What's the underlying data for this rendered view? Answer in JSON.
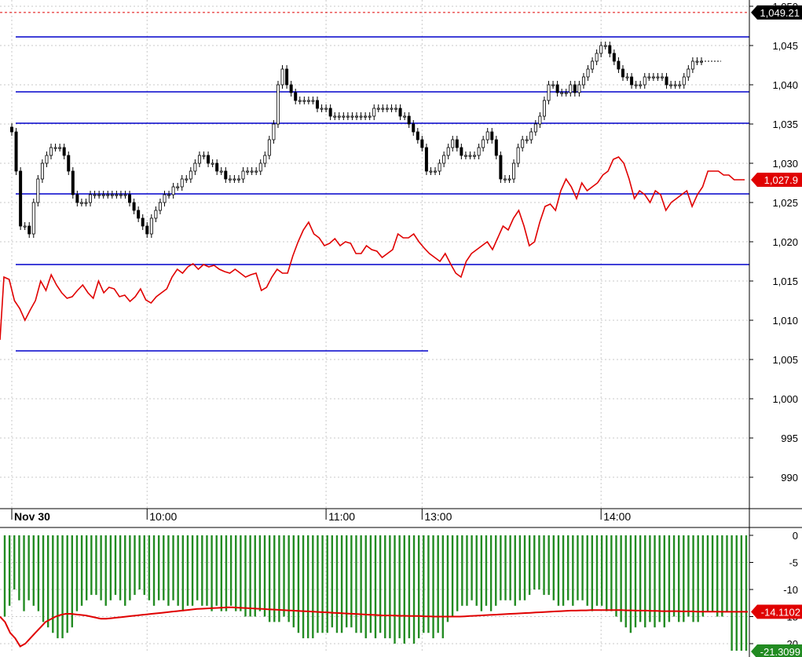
{
  "chart_data": [
    {
      "type": "candlestick",
      "title": "",
      "xlabel": "",
      "ylabel": "",
      "ylim": [
        985,
        1050
      ],
      "yticks": [
        990,
        995,
        1000,
        1005,
        1010,
        1015,
        1020,
        1025,
        1030,
        1035,
        1040,
        1045,
        1050
      ],
      "ytick_labels": [
        "990",
        "995",
        "1,000",
        "1,005",
        "1,010",
        "1,015",
        "1,020",
        "1,025",
        "1,030",
        "1,035",
        "1,040",
        "1,045",
        "1,050"
      ],
      "x_tick_labels": [
        {
          "label": "Nov 30",
          "index": 0
        },
        {
          "label": "10:00",
          "index": 31
        },
        {
          "label": "11:00",
          "index": 72
        },
        {
          "label": "13:00",
          "index": 94
        },
        {
          "label": "14:00",
          "index": 135
        }
      ],
      "grid": true,
      "last_price_line": 1027.9,
      "last_price_label": "1,027.9",
      "reference_line": 1049.21,
      "reference_label": "1,049.21",
      "horizontal_lines": [
        1046.1,
        1039.1,
        1035.1,
        1026.1,
        1017.1,
        1006.1
      ],
      "candles_close": [
        1034,
        1029,
        1022,
        1022,
        1021,
        1025,
        1028,
        1030,
        1031,
        1032,
        1032,
        1032,
        1031,
        1029,
        1026,
        1025,
        1025,
        1025,
        1026,
        1026,
        1026,
        1026,
        1026,
        1026,
        1026,
        1026,
        1026,
        1025,
        1024,
        1023,
        1022,
        1021,
        1023,
        1024,
        1025,
        1026,
        1026,
        1027,
        1027,
        1028,
        1028,
        1029,
        1030,
        1031,
        1031,
        1030,
        1030,
        1029,
        1029,
        1028,
        1028,
        1028,
        1028,
        1029,
        1029,
        1029,
        1029,
        1030,
        1031,
        1033,
        1035,
        1040,
        1042,
        1040,
        1039,
        1038,
        1038,
        1038,
        1038,
        1038,
        1037,
        1037,
        1037,
        1036,
        1036,
        1036,
        1036,
        1036,
        1036,
        1036,
        1036,
        1036,
        1036,
        1037,
        1037,
        1037,
        1037,
        1037,
        1037,
        1036,
        1036,
        1035,
        1034,
        1033,
        1032,
        1029,
        1029,
        1029,
        1030,
        1031,
        1032,
        1033,
        1032,
        1031,
        1031,
        1031,
        1031,
        1032,
        1033,
        1034,
        1033,
        1031,
        1028,
        1028,
        1028,
        1030,
        1032,
        1033,
        1033,
        1034,
        1035,
        1036,
        1038,
        1040,
        1040,
        1039,
        1039,
        1039,
        1040,
        1039,
        1040,
        1041,
        1042,
        1043,
        1044,
        1045,
        1045,
        1044,
        1043,
        1042,
        1041,
        1041,
        1040,
        1040,
        1040,
        1041,
        1041,
        1041,
        1041,
        1041,
        1040,
        1040,
        1040,
        1040,
        1041,
        1042,
        1043,
        1043,
        1043
      ],
      "series": [
        {
          "color": "#e00000",
          "values": [
            1015.5,
            1015.2,
            1012.5,
            1011.5,
            1010.0,
            1011.3,
            1012.5,
            1015.0,
            1013.8,
            1015.8,
            1014.5,
            1013.5,
            1012.8,
            1013.0,
            1013.8,
            1014.5,
            1013.5,
            1012.8,
            1015.0,
            1013.5,
            1014.2,
            1014.0,
            1013.0,
            1013.2,
            1012.4,
            1013.0,
            1014.0,
            1012.6,
            1012.2,
            1013.0,
            1013.5,
            1014.0,
            1015.5,
            1016.5,
            1016.0,
            1016.8,
            1017.2,
            1016.5,
            1017.1,
            1016.8,
            1017.0,
            1016.5,
            1016.2,
            1016.0,
            1016.5,
            1016.0,
            1015.5,
            1015.8,
            1016.0,
            1013.8,
            1014.2,
            1015.5,
            1016.5,
            1016.0,
            1016.0,
            1018.2,
            1020.0,
            1021.5,
            1022.5,
            1021.0,
            1020.5,
            1019.5,
            1019.8,
            1020.4,
            1019.5,
            1020.0,
            1019.8,
            1018.5,
            1018.5,
            1019.5,
            1019.0,
            1018.8,
            1018.0,
            1018.5,
            1019.0,
            1021.0,
            1020.5,
            1020.5,
            1021.0,
            1020.0,
            1019.2,
            1018.5,
            1018.0,
            1017.5,
            1018.5,
            1017.2,
            1016.0,
            1015.5,
            1017.5,
            1018.5,
            1019.0,
            1019.5,
            1020.0,
            1019.0,
            1020.5,
            1022.0,
            1021.5,
            1023.0,
            1024.0,
            1022.0,
            1019.5,
            1020.0,
            1022.5,
            1024.5,
            1024.8,
            1024.0,
            1026.5,
            1028.0,
            1027.0,
            1025.5,
            1027.5,
            1026.5,
            1027.0,
            1027.5,
            1028.5,
            1029.0,
            1030.5,
            1030.8,
            1030.0,
            1028.0,
            1025.5,
            1026.5,
            1026.0,
            1025.0,
            1026.5,
            1026.0,
            1024.0,
            1025.0,
            1025.5,
            1026.0,
            1026.5,
            1024.5,
            1026.0,
            1027.0,
            1029.0,
            1029.0,
            1029.0,
            1028.5,
            1028.5,
            1027.9,
            1027.9,
            1027.9
          ]
        }
      ]
    },
    {
      "type": "bar",
      "title": "",
      "xlabel": "",
      "ylabel": "",
      "ylim": [
        -21,
        1
      ],
      "yticks": [
        0,
        -5,
        -10,
        -15,
        -20
      ],
      "ytick_labels": [
        "0",
        "-5",
        "-10",
        "-15",
        "-20"
      ],
      "last_value_label": "-14.1102",
      "last_value_line": -14.1102,
      "min_value_label": "-21.3099",
      "bar_color": "#228b22",
      "line_color": "#e00000",
      "values": [
        -15,
        -13,
        -10,
        -12,
        -14,
        -12,
        -13,
        -14,
        -16,
        -17,
        -18,
        -19,
        -19,
        -18,
        -17,
        -14,
        -13,
        -12,
        -11,
        -11,
        -12,
        -13,
        -12,
        -11,
        -12,
        -13,
        -12,
        -11,
        -10,
        -11,
        -12,
        -13,
        -12,
        -12,
        -13,
        -12,
        -13,
        -14,
        -13,
        -13,
        -12,
        -13,
        -13,
        -14,
        -13,
        -14,
        -14,
        -13,
        -14,
        -14,
        -15,
        -15,
        -15,
        -14,
        -15,
        -16,
        -16,
        -16,
        -15,
        -16,
        -17,
        -18,
        -19,
        -19,
        -19,
        -18,
        -18,
        -18,
        -17,
        -18,
        -18,
        -17,
        -17,
        -18,
        -18,
        -19,
        -18,
        -19,
        -18,
        -19,
        -19,
        -20,
        -19,
        -20,
        -19,
        -20,
        -19,
        -18,
        -18,
        -19,
        -18,
        -19,
        -16,
        -15,
        -14,
        -13,
        -13,
        -12,
        -13,
        -14,
        -13,
        -14,
        -13,
        -12,
        -12,
        -12,
        -13,
        -12,
        -12,
        -11,
        -10,
        -10,
        -11,
        -11,
        -12,
        -13,
        -13,
        -12,
        -13,
        -12,
        -12,
        -13,
        -14,
        -13,
        -13,
        -14,
        -14,
        -15,
        -16,
        -17,
        -18,
        -17,
        -16,
        -17,
        -16,
        -17,
        -16,
        -17,
        -16,
        -15,
        -16,
        -16,
        -15,
        -16,
        -16,
        -15,
        -14,
        -14,
        -15,
        -15,
        -14,
        -21.3,
        -21.3,
        -21.3,
        -21.3
      ],
      "line_values": [
        -15,
        -16,
        -18,
        -19,
        -20.5,
        -20,
        -19,
        -18,
        -17,
        -16,
        -15.5,
        -15,
        -14.7,
        -14.5,
        -14.5,
        -14.6,
        -14.7,
        -14.8,
        -15,
        -15.2,
        -15.4,
        -15.4,
        -15.3,
        -15.2,
        -15.1,
        -15,
        -14.9,
        -14.8,
        -14.7,
        -14.6,
        -14.5,
        -14.4,
        -14.3,
        -14.2,
        -14.1,
        -14.0,
        -13.9,
        -13.8,
        -13.7,
        -13.6,
        -13.55,
        -13.5,
        -13.45,
        -13.4,
        -13.35,
        -13.3,
        -13.3,
        -13.35,
        -13.4,
        -13.45,
        -13.5,
        -13.55,
        -13.6,
        -13.65,
        -13.7,
        -13.75,
        -13.8,
        -13.85,
        -13.9,
        -13.95,
        -14.0,
        -14.05,
        -14.1,
        -14.15,
        -14.2,
        -14.25,
        -14.3,
        -14.35,
        -14.4,
        -14.45,
        -14.5,
        -14.55,
        -14.6,
        -14.65,
        -14.7,
        -14.75,
        -14.8,
        -14.8,
        -14.8,
        -14.85,
        -14.85,
        -14.9,
        -14.9,
        -14.9,
        -14.95,
        -14.95,
        -15.0,
        -15.0,
        -15.0,
        -15.0,
        -15.0,
        -15.0,
        -14.95,
        -14.9,
        -14.85,
        -14.8,
        -14.75,
        -14.7,
        -14.65,
        -14.6,
        -14.55,
        -14.5,
        -14.45,
        -14.4,
        -14.35,
        -14.3,
        -14.25,
        -14.2,
        -14.15,
        -14.1,
        -14.05,
        -14.0,
        -13.95,
        -13.9,
        -13.9,
        -13.85,
        -13.85,
        -13.8,
        -13.8,
        -13.8,
        -13.8,
        -13.8,
        -13.8,
        -13.8,
        -13.85,
        -13.85,
        -13.9,
        -13.9,
        -13.9,
        -13.95,
        -13.95,
        -14.0,
        -14.0,
        -14.0,
        -14.0,
        -14.05,
        -14.05,
        -14.05,
        -14.1,
        -14.1,
        -14.1,
        -14.1,
        -14.1,
        -14.1102,
        -14.1102,
        -14.1102,
        -14.1102,
        -14.1102,
        -14.1102
      ]
    }
  ]
}
